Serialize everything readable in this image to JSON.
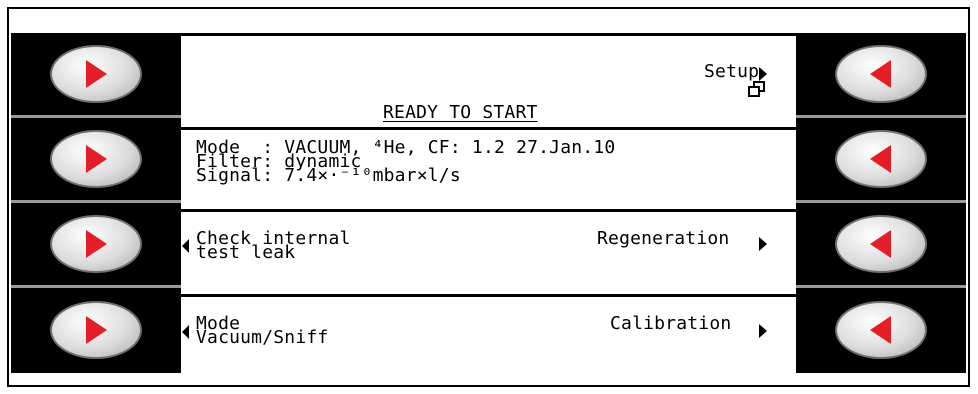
{
  "header": {
    "title": "READY TO START",
    "setup_label": "Setup"
  },
  "status": {
    "mode_line": "Mode  : VACUUM, ⁴He, CF: 1.2 27.Jan.10",
    "filter_line": "Filter: dynamic",
    "signal_line": "Signal: 7.4×·⁻¹⁰mbar×l/s"
  },
  "menu": {
    "check_line1": "Check internal",
    "check_line2": "test leak",
    "regeneration_label": "Regeneration",
    "mode_line1": "Mode",
    "mode_line2": "Vacuum/Sniff",
    "calibration_label": "Calibration"
  },
  "colors": {
    "arrow": "#e41e26",
    "panel": "#000000",
    "separator": "#9a9a9a"
  },
  "icons": {
    "left_keys": "play-right-icon",
    "right_keys": "play-left-icon",
    "setup": "window-stack-icon"
  }
}
